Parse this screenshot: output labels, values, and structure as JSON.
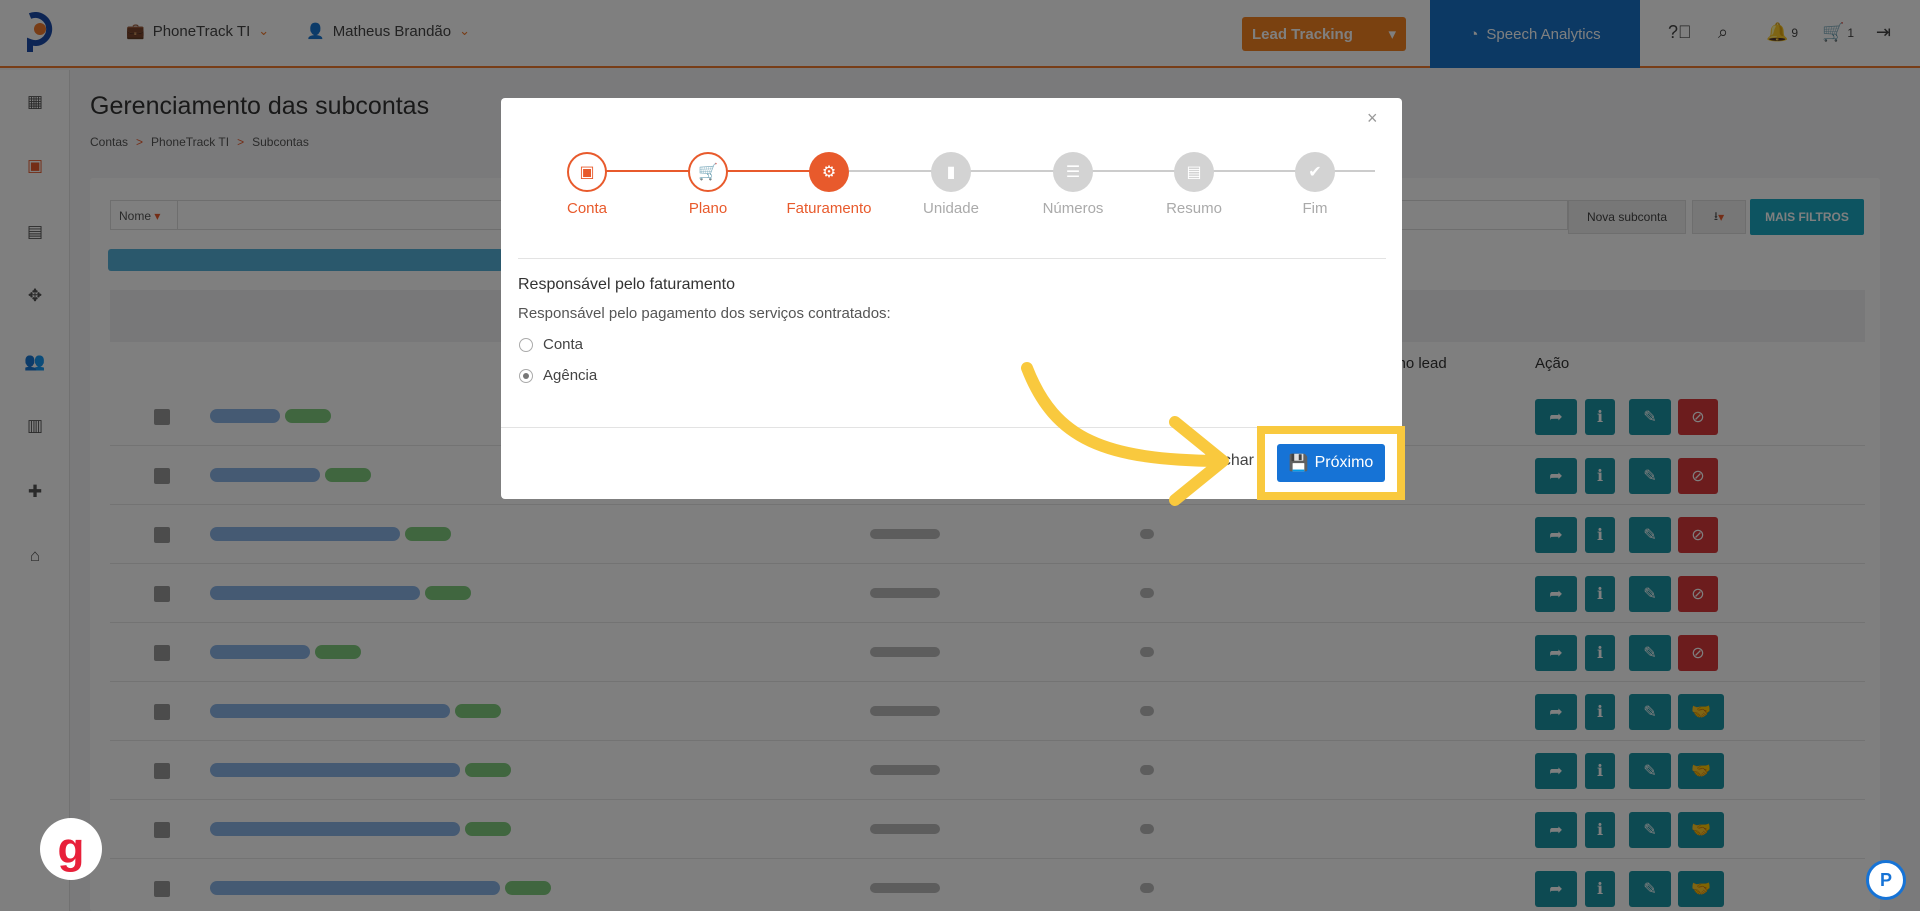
{
  "topbar": {
    "company": "PhoneTrack TI",
    "user": "Matheus Brandão",
    "lead_tracking": "Lead Tracking",
    "speech_analytics": "Speech Analytics",
    "notifications_count": "9",
    "cart_count": "1"
  },
  "page": {
    "title": "Gerenciamento das subcontas",
    "breadcrumb": [
      "Contas",
      "PhoneTrack TI",
      "Subcontas"
    ],
    "breadcrumb_sep": ">"
  },
  "filters": {
    "field_select": "Nome",
    "nova_subconta": "Nova subconta",
    "mais_filtros": "MAIS FILTROS"
  },
  "table": {
    "col_last_lead_partial": "imo lead",
    "col_action": "Ação"
  },
  "modal": {
    "steps": [
      {
        "label": "Conta",
        "state": "done"
      },
      {
        "label": "Plano",
        "state": "done"
      },
      {
        "label": "Faturamento",
        "state": "active"
      },
      {
        "label": "Unidade",
        "state": "todo"
      },
      {
        "label": "Números",
        "state": "todo"
      },
      {
        "label": "Resumo",
        "state": "todo"
      },
      {
        "label": "Fim",
        "state": "todo"
      }
    ],
    "section_title": "Responsável pelo faturamento",
    "section_desc": "Responsável pelo pagamento dos serviços contratados:",
    "options": [
      {
        "label": "Conta",
        "checked": false
      },
      {
        "label": "Agência",
        "checked": true
      }
    ],
    "close_label": "Fechar",
    "next_label": "Próximo"
  },
  "colors": {
    "brand_orange": "#e85a2c",
    "primary_blue": "#1673d6",
    "teal": "#1b95a5",
    "highlight": "#f9c93e"
  }
}
